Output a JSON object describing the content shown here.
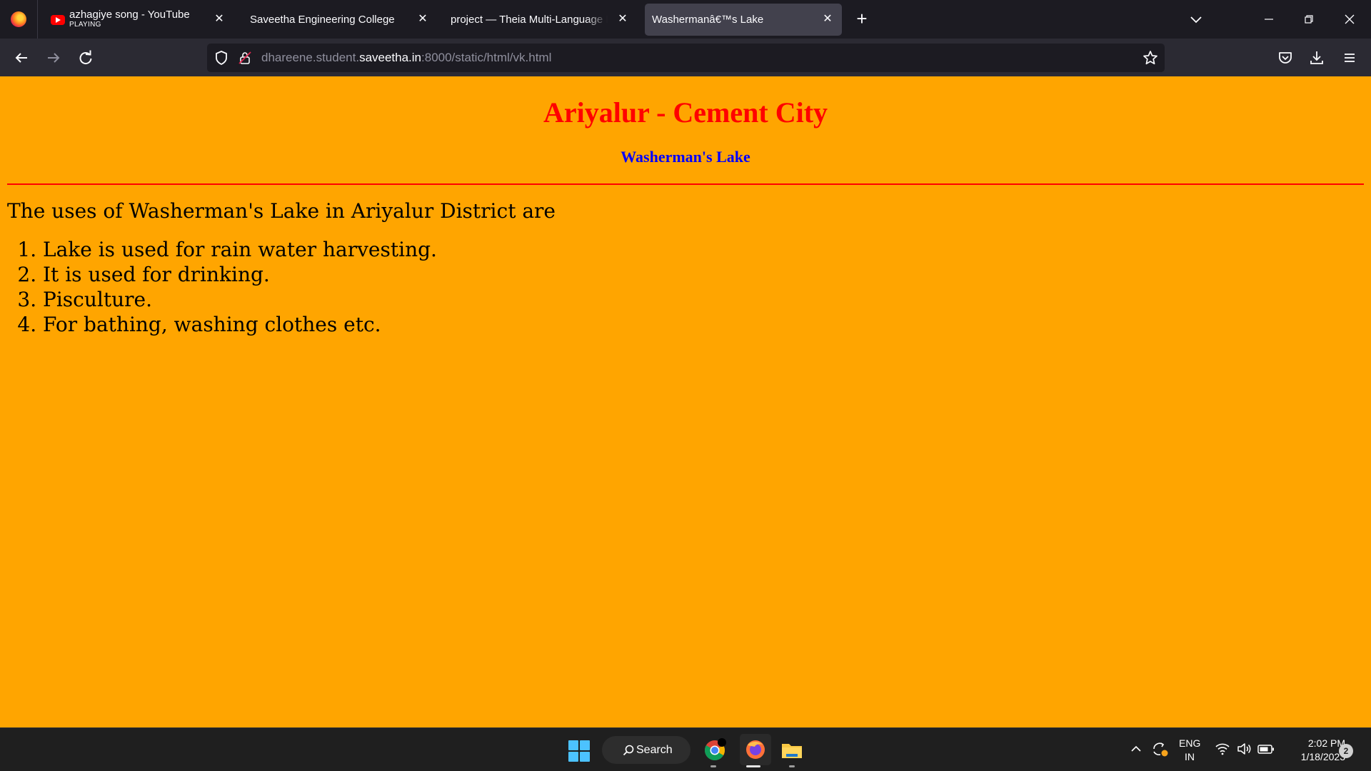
{
  "browser": {
    "tabs": [
      {
        "title": "azhagiye song - YouTube",
        "subtitle": "PLAYING",
        "icon": "youtube-icon",
        "active": false
      },
      {
        "title": "Saveetha Engineering College",
        "active": false
      },
      {
        "title": "project — Theia Multi-Language Example",
        "active": false
      },
      {
        "title": "Washermanâ€™s Lake",
        "active": true
      }
    ],
    "address": {
      "prefix": "dhareene.student.",
      "host": "saveetha.in",
      "suffix": ":8000/static/html/vk.html"
    }
  },
  "page": {
    "heading": "Ariyalur - Cement City",
    "subheading": "Washerman's Lake",
    "intro": "The uses of Washerman's Lake in Ariyalur District are",
    "uses": [
      "Lake is used for rain water harvesting.",
      "It is used for drinking.",
      "Pisculture.",
      "For bathing, washing clothes etc."
    ],
    "colors": {
      "background": "#ffa500",
      "heading": "#ff0000",
      "subheading": "#0000ff",
      "rule": "#ff0000"
    }
  },
  "taskbar": {
    "search_label": "Search",
    "lang_top": "ENG",
    "lang_bottom": "IN",
    "time": "2:02 PM",
    "date": "1/18/2023",
    "notification_count": "2"
  }
}
